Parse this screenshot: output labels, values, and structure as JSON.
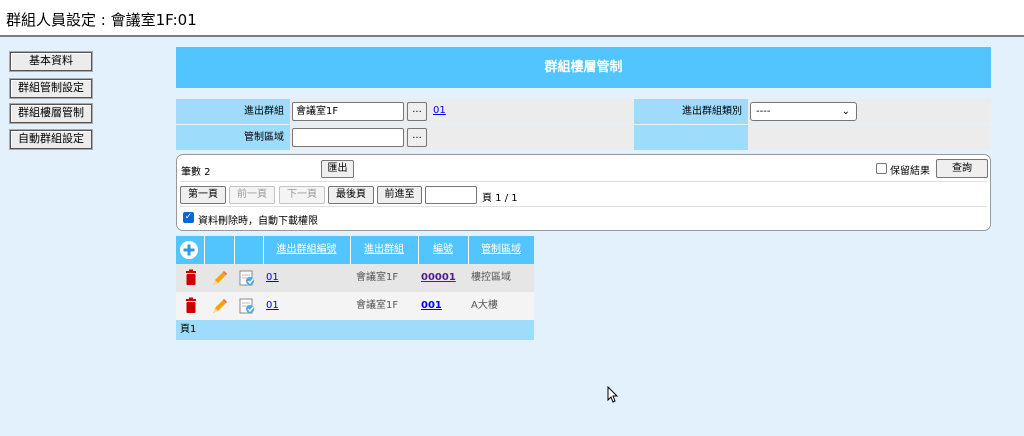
{
  "header": {
    "title": "群組人員設定 : 會議室1F:01"
  },
  "sidebar": {
    "buttons": [
      {
        "label": "基本資料"
      },
      {
        "label": "群組管制設定"
      },
      {
        "label": "群組樓層管制"
      },
      {
        "label": "自動群組設定"
      }
    ]
  },
  "banner": {
    "title": "群組樓層管制"
  },
  "form": {
    "group_label": "進出群組",
    "group_value": "會議室1F",
    "group_browse": "...",
    "group_code_link": "01",
    "group_type_label": "進出群組類別",
    "group_type_value": "----",
    "control_area_label": "管制區域",
    "control_area_value": "",
    "control_area_browse": "..."
  },
  "query": {
    "count_label": "筆數 2",
    "export_label": "匯出",
    "keep_result_label": "保留結果",
    "search_label": "查詢",
    "first_page": "第一頁",
    "prev_page": "前一頁",
    "next_page": "下一頁",
    "last_page": "最後頁",
    "goto_label": "前進至",
    "goto_value": "",
    "page_info": "頁 1 / 1",
    "auto_download_label": "資料刪除時，自動下載權限"
  },
  "grid": {
    "add_icon": "plus-icon",
    "columns": [
      "進出群組編號",
      "進出群組",
      "編號",
      "管制區域"
    ],
    "rows": [
      {
        "group_code": "01",
        "group_name": "會議室1F",
        "code": "00001",
        "area": "樓控區域"
      },
      {
        "group_code": "01",
        "group_name": "會議室1F",
        "code": "001",
        "area": "A大樓"
      }
    ],
    "footer": "頁1"
  },
  "colors": {
    "accent": "#52c5ff",
    "label_bg": "#9fdcfc",
    "page_bg": "#e3f1fc",
    "delete_icon": "#cc0000"
  }
}
